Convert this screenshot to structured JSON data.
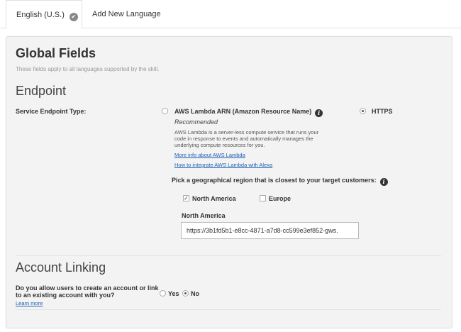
{
  "tabs": {
    "active_label": "English (U.S.)",
    "add_label": "Add New Language"
  },
  "global_fields": {
    "title": "Global Fields",
    "subtitle": "These fields apply to all languages supported by the skill."
  },
  "endpoint": {
    "heading": "Endpoint",
    "type_label": "Service Endpoint Type:",
    "lambda_option": "AWS Lambda ARN (Amazon Resource Name)",
    "lambda_selected": false,
    "recommended": "Recommended",
    "lambda_description": "AWS Lambda is a server-less compute service that runs your code in response to events and automatically manages the underlying compute resources for you.",
    "link_more_info": "More info about AWS Lambda",
    "link_integrate": "How to integrate AWS Lambda with Alexa",
    "https_option": "HTTPS",
    "https_selected": true,
    "region_prompt": "Pick a geographical region that is closest to your target customers:",
    "regions": [
      {
        "label": "North America",
        "checked": true
      },
      {
        "label": "Europe",
        "checked": false
      }
    ],
    "na_field_label": "North America",
    "na_url_value": "https://3b1fd5b1-e8cc-4871-a7d8-cc599e3ef852-gws."
  },
  "account_linking": {
    "heading": "Account Linking",
    "question": "Do you allow users to create an account or link to an existing account with you?",
    "learn_more": "Learn more",
    "yes_label": "Yes",
    "no_label": "No",
    "selected": "No"
  }
}
